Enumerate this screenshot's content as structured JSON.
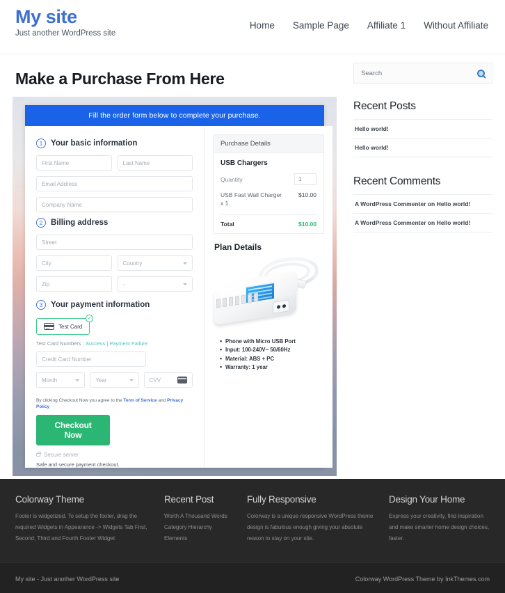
{
  "header": {
    "site_title": "My site",
    "tagline": "Just another WordPress site",
    "nav": [
      {
        "label": "Home"
      },
      {
        "label": "Sample Page"
      },
      {
        "label": "Affiliate 1"
      },
      {
        "label": "Without Affiliate"
      }
    ]
  },
  "main": {
    "page_title": "Make a Purchase From Here",
    "form": {
      "banner": "Fill the order form below to complete your purchase.",
      "steps": [
        {
          "num": "1",
          "label": "Your basic information"
        },
        {
          "num": "2",
          "label": "Billing address"
        },
        {
          "num": "3",
          "label": "Your payment information"
        }
      ],
      "fields": {
        "first_name": "First Name",
        "last_name": "Last Name",
        "email": "Email Address",
        "company": "Company Name",
        "street": "Street",
        "city": "City",
        "country": "Country",
        "zip": "Zip",
        "state": "-",
        "credit_card_number": "Credit Card Number",
        "month": "Month",
        "year": "Year",
        "cvv": "CVV"
      },
      "test_card_chip": "Test Card",
      "test_numbers_prefix": "Test Card Numbers : ",
      "test_numbers_success": "Success",
      "test_numbers_sep": " | ",
      "test_numbers_failure": "Payment Failure",
      "terms_prefix": "By clicking Checkout Now you agree to the ",
      "terms_tos": "Term of Service",
      "terms_and": " and ",
      "terms_privacy": "Privacy Policy",
      "checkout_label": "Checkout Now",
      "secure_server": "Secure server",
      "safe_note": "Safe and secure payment checkout."
    },
    "purchase_details": {
      "heading": "Purchase Details",
      "product": "USB Chargers",
      "quantity_label": "Quantity",
      "quantity_value": "1",
      "line_item_name": "USB Fast Wall Charger x 1",
      "line_item_price": "$10.00",
      "total_label": "Total",
      "total_value": "$10.00"
    },
    "plan": {
      "title": "Plan Details",
      "features": [
        "Phone with Micro USB Port",
        "Input: 100-240V~ 50/60Hz",
        "Material: ABS + PC",
        "Warranty: 1 year"
      ]
    }
  },
  "sidebar": {
    "search_placeholder": "Search",
    "widgets": [
      {
        "title": "Recent Posts",
        "items": [
          "Hello world!",
          "Hello world!"
        ]
      },
      {
        "title": "Recent Comments",
        "items": [
          "A WordPress Commenter on Hello world!",
          "A WordPress Commenter on Hello world!"
        ]
      }
    ]
  },
  "footer": {
    "columns": [
      {
        "title": "Colorway Theme",
        "text": "Footer is widgetized. To setup the footer, drag the required Widgets in Appearance -> Widgets Tab First, Second, Third and Fourth Footer Widget"
      },
      {
        "title": "Recent Post",
        "items": [
          "Worth A Thousand Words",
          "Category Hierarchy",
          "Elements"
        ]
      },
      {
        "title": "Fully Responsive",
        "text": "Colorway is a unique responsive WordPress theme design is fabulous enough giving your absolute reason to stay on your site."
      },
      {
        "title": "Design Your Home",
        "text": "Express your creativity, find inspiration and make smarter home design choices, faster."
      }
    ],
    "copyright_left": "My site - Just another WordPress site",
    "copyright_right": "Colorway WordPress Theme by InkThemes.com"
  },
  "colors": {
    "brand_blue": "#3c6fd1",
    "banner_blue": "#1a62e8",
    "success_green": "#2bb673",
    "link_teal": "#46c3c9",
    "footer_dark": "#282828"
  }
}
